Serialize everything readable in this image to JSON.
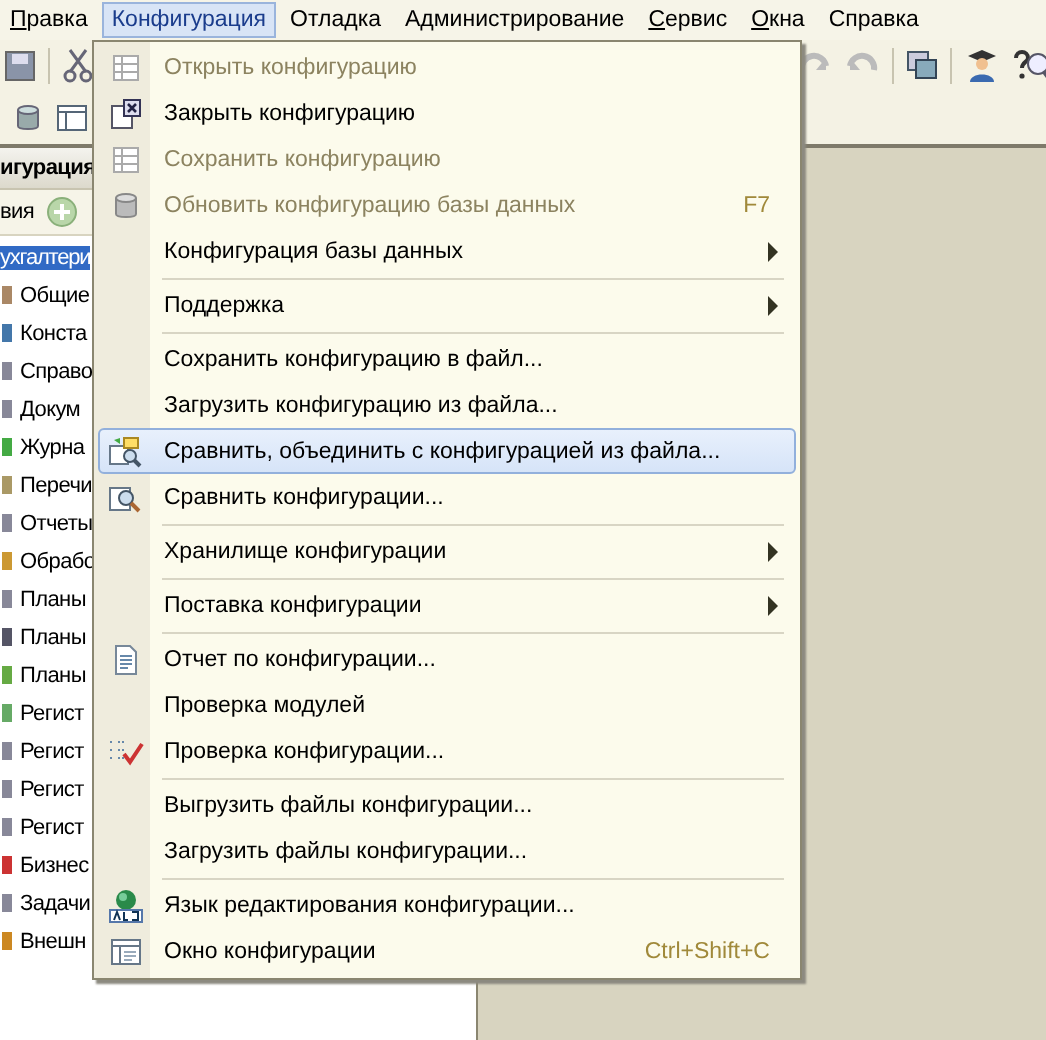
{
  "menubar": [
    {
      "label": "Правка",
      "mnemonic_first": true,
      "selected": false
    },
    {
      "label": "Конфигурация",
      "mnemonic_first": false,
      "selected": true
    },
    {
      "label": "Отладка",
      "mnemonic_first": false,
      "selected": false
    },
    {
      "label": "Администрирование",
      "mnemonic_first": false,
      "selected": false
    },
    {
      "label": "Сервис",
      "mnemonic_first": true,
      "selected": false
    },
    {
      "label": "Окна",
      "mnemonic_first": true,
      "selected": false
    },
    {
      "label": "Справка",
      "mnemonic_first": false,
      "selected": false
    }
  ],
  "menu": {
    "items": [
      {
        "kind": "item",
        "label": "Открыть конфигурацию",
        "disabled": true,
        "selected": false
      },
      {
        "kind": "item",
        "label": "Закрыть конфигурацию",
        "disabled": false,
        "selected": false
      },
      {
        "kind": "item",
        "label": "Сохранить конфигурацию",
        "disabled": true,
        "selected": false
      },
      {
        "kind": "item",
        "label": "Обновить конфигурацию базы данных",
        "disabled": true,
        "selected": false,
        "shortcut": "F7"
      },
      {
        "kind": "item",
        "label": "Конфигурация базы данных",
        "disabled": false,
        "selected": false,
        "submenu": true
      },
      {
        "kind": "separator"
      },
      {
        "kind": "item",
        "label": "Поддержка",
        "disabled": false,
        "selected": false,
        "submenu": true
      },
      {
        "kind": "separator"
      },
      {
        "kind": "item",
        "label": "Сохранить конфигурацию в файл...",
        "disabled": false,
        "selected": false
      },
      {
        "kind": "item",
        "label": "Загрузить конфигурацию из файла...",
        "disabled": false,
        "selected": false
      },
      {
        "kind": "item",
        "label": "Сравнить, объединить с конфигурацией из файла...",
        "disabled": false,
        "selected": true
      },
      {
        "kind": "item",
        "label": "Сравнить конфигурации...",
        "disabled": false,
        "selected": false
      },
      {
        "kind": "separator"
      },
      {
        "kind": "item",
        "label": "Хранилище конфигурации",
        "disabled": false,
        "selected": false,
        "submenu": true
      },
      {
        "kind": "separator"
      },
      {
        "kind": "item",
        "label": "Поставка конфигурации",
        "disabled": false,
        "selected": false,
        "submenu": true
      },
      {
        "kind": "separator"
      },
      {
        "kind": "item",
        "label": "Отчет по конфигурации...",
        "disabled": false,
        "selected": false
      },
      {
        "kind": "item",
        "label": "Проверка модулей",
        "disabled": false,
        "selected": false
      },
      {
        "kind": "item",
        "label": "Проверка конфигурации...",
        "disabled": false,
        "selected": false
      },
      {
        "kind": "separator"
      },
      {
        "kind": "item",
        "label": "Выгрузить файлы конфигурации...",
        "disabled": false,
        "selected": false
      },
      {
        "kind": "item",
        "label": "Загрузить файлы конфигурации...",
        "disabled": false,
        "selected": false
      },
      {
        "kind": "separator"
      },
      {
        "kind": "item",
        "label": "Язык редактирования конфигурации...",
        "disabled": false,
        "selected": false
      },
      {
        "kind": "item",
        "label": "Окно конфигурации",
        "disabled": false,
        "selected": false,
        "shortcut": "Ctrl+Shift+C"
      }
    ]
  },
  "panel": {
    "title": "игурация",
    "actions": "вия",
    "tree": [
      {
        "label": "ухгалтери",
        "selected": true,
        "children": [
          {
            "label": "Общие",
            "selected": false
          },
          {
            "label": "Конста",
            "selected": false
          },
          {
            "label": "Справо",
            "selected": false
          },
          {
            "label": "Докум",
            "selected": false
          },
          {
            "label": "Журна",
            "selected": false
          },
          {
            "label": "Перечи",
            "selected": false
          },
          {
            "label": "Отчеты",
            "selected": false
          },
          {
            "label": "Обрабо",
            "selected": false
          },
          {
            "label": "Планы",
            "selected": false
          },
          {
            "label": "Планы",
            "selected": false
          },
          {
            "label": "Планы",
            "selected": false
          },
          {
            "label": "Регист",
            "selected": false
          },
          {
            "label": "Регист",
            "selected": false
          },
          {
            "label": "Регист",
            "selected": false
          },
          {
            "label": "Регист",
            "selected": false
          },
          {
            "label": "Бизнес",
            "selected": false
          },
          {
            "label": "Задачи",
            "selected": false
          },
          {
            "label": "Внешн",
            "selected": false
          }
        ]
      }
    ]
  }
}
